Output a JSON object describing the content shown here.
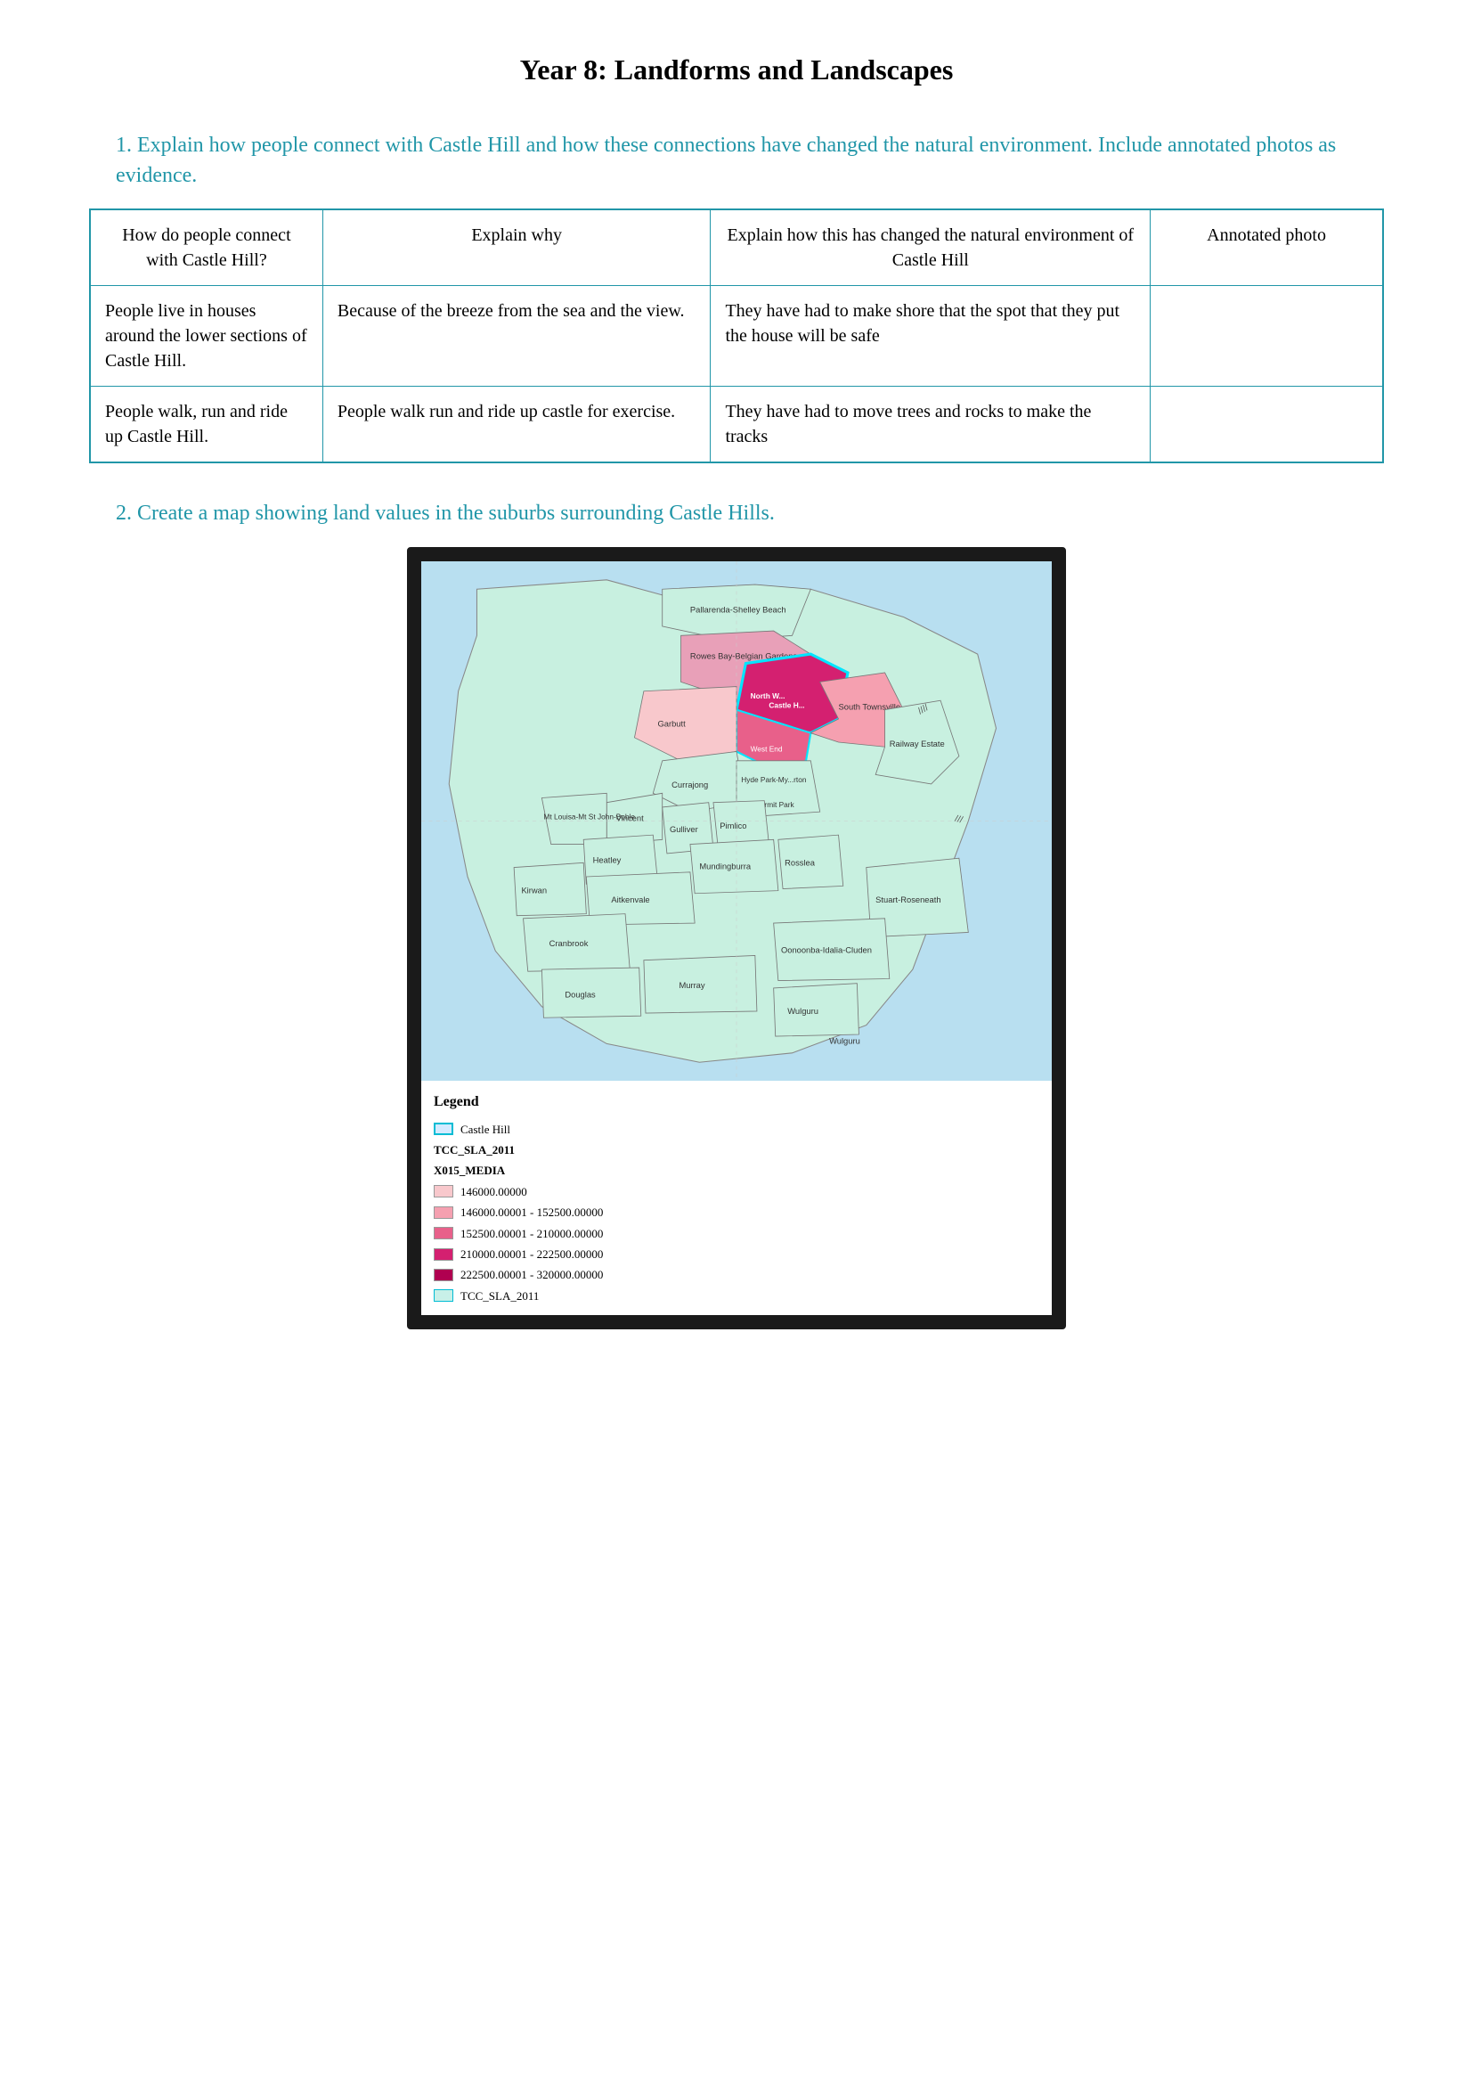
{
  "page": {
    "title": "Year 8: Landforms and Landscapes"
  },
  "question1": {
    "number": "1.",
    "text": "Explain how people connect with Castle Hill and how these connections have changed the natural environment. Include annotated photos as evidence."
  },
  "table": {
    "headers": [
      "How do people connect with Castle Hill?",
      "Explain why",
      "Explain how this has changed the natural environment of Castle Hill",
      "Annotated photo"
    ],
    "rows": [
      {
        "connect": "People live in houses around the lower sections of Castle Hill.",
        "why": "Because of the breeze from the sea and the view.",
        "changed": "They have had to make shore that the spot that they put the house will be safe",
        "photo": ""
      },
      {
        "connect": "People walk, run and ride up Castle Hill.",
        "why": "People walk run and ride up castle for exercise.",
        "changed": "They have had to move trees and rocks to make the tracks",
        "photo": ""
      }
    ]
  },
  "question2": {
    "number": "2.",
    "text": "Create a map showing land values in the suburbs surrounding Castle Hills."
  },
  "legend": {
    "title": "Legend",
    "castle_hill_label": "Castle Hill",
    "tcc_sla": "TCC_SLA_2011",
    "x015_media": "X015_MEDIA",
    "items": [
      {
        "color": "#f8c8cc",
        "label": "146000.00000"
      },
      {
        "color": "#f5a0b0",
        "label": "146000.00001 - 152500.00000"
      },
      {
        "color": "#e8608a",
        "label": "152500.00001 - 210000.00000"
      },
      {
        "color": "#d42070",
        "label": "210000.00001 - 222500.00000"
      },
      {
        "color": "#b00050",
        "label": "222500.00001 - 320000.00000"
      },
      {
        "color": "#c8f0e8",
        "label": "TCC_SLA_2011",
        "border": "#00bcd4"
      }
    ]
  }
}
